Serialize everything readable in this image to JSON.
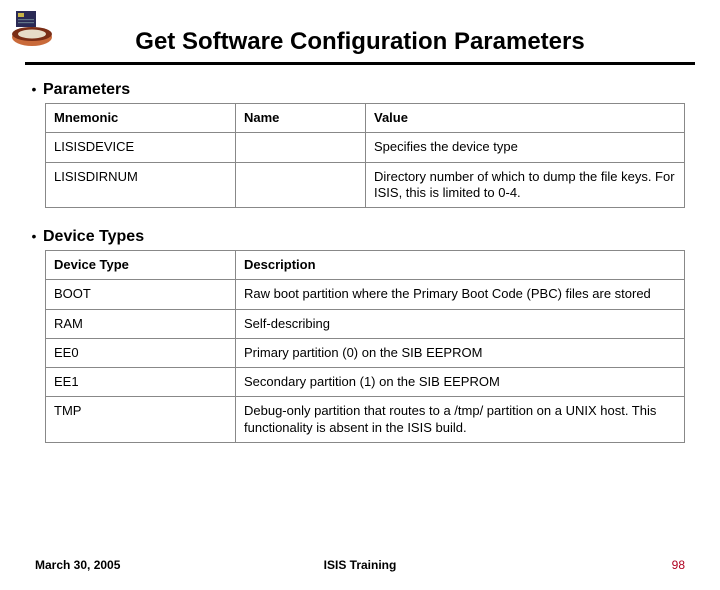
{
  "slide": {
    "title": "Get Software Configuration Parameters"
  },
  "sections": {
    "parameters": {
      "heading": "Parameters",
      "headers": {
        "c1": "Mnemonic",
        "c2": "Name",
        "c3": "Value"
      },
      "rows": [
        {
          "c1": "LISISDEVICE",
          "c2": "",
          "c3": "Specifies the device type"
        },
        {
          "c1": "LISISDIRNUM",
          "c2": "",
          "c3": "Directory number of which to dump the file keys. For ISIS, this is limited to 0-4."
        }
      ]
    },
    "device_types": {
      "heading": "Device Types",
      "headers": {
        "c1": "Device Type",
        "c2": "Description"
      },
      "rows": [
        {
          "c1": "BOOT",
          "c2": "Raw boot partition where the Primary Boot Code (PBC) files are stored"
        },
        {
          "c1": "RAM",
          "c2": "Self-describing"
        },
        {
          "c1": "EE0",
          "c2": "Primary partition (0) on the SIB EEPROM"
        },
        {
          "c1": "EE1",
          "c2": "Secondary partition (1) on the SIB EEPROM"
        },
        {
          "c1": "TMP",
          "c2": "Debug-only partition that routes to a /tmp/ partition on a UNIX host. This functionality is absent in the ISIS build."
        }
      ]
    }
  },
  "footer": {
    "date": "March 30, 2005",
    "center": "ISIS Training",
    "page": "98"
  },
  "logo": {
    "name": "mission-logo"
  }
}
